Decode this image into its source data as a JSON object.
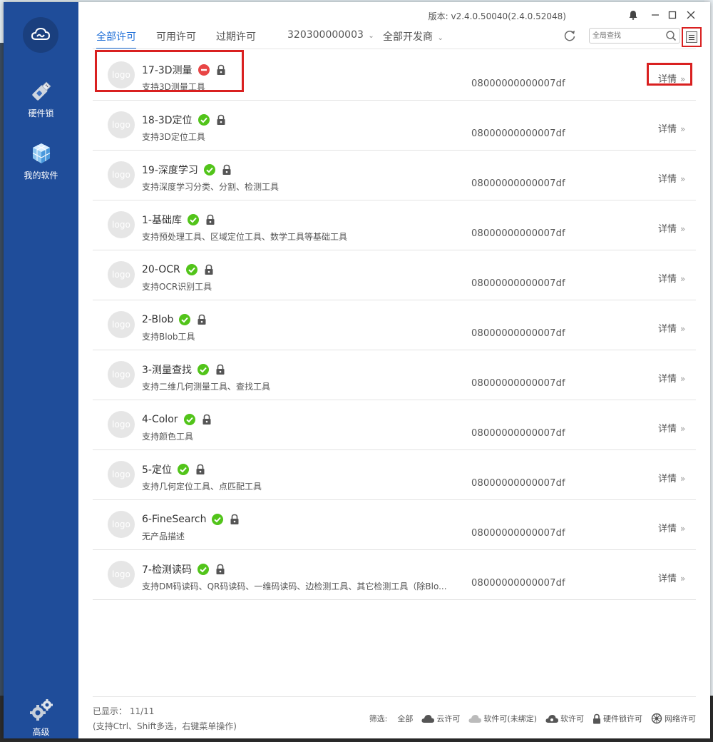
{
  "window": {
    "version": "版本: v2.4.0.50040(2.4.0.52048)"
  },
  "sidebar": {
    "items": [
      {
        "label": "硬件锁",
        "icon": "usb-dongle-icon"
      },
      {
        "label": "我的软件",
        "icon": "cubes-icon"
      },
      {
        "label": "高级",
        "icon": "gears-icon"
      }
    ]
  },
  "tabs": [
    {
      "label": "全部许可",
      "active": true
    },
    {
      "label": "可用许可",
      "active": false
    },
    {
      "label": "过期许可",
      "active": false
    }
  ],
  "filters_top": {
    "dongle_select": "320300000003",
    "vendor_select": "全部开发商"
  },
  "search": {
    "placeholder": "全局查找"
  },
  "licenses": [
    {
      "name": "17-3D测量",
      "status": "invalid",
      "desc": "支持3D测量工具",
      "serial": "08000000000007df",
      "detail": "详情"
    },
    {
      "name": "18-3D定位",
      "status": "valid",
      "desc": "支持3D定位工具",
      "serial": "08000000000007df",
      "detail": "详情"
    },
    {
      "name": "19-深度学习",
      "status": "valid",
      "desc": "支持深度学习分类、分割、检测工具",
      "serial": "08000000000007df",
      "detail": "详情"
    },
    {
      "name": "1-基础库",
      "status": "valid",
      "desc": "支持预处理工具、区域定位工具、数学工具等基础工具",
      "serial": "08000000000007df",
      "detail": "详情"
    },
    {
      "name": "20-OCR",
      "status": "valid",
      "desc": "支持OCR识别工具",
      "serial": "08000000000007df",
      "detail": "详情"
    },
    {
      "name": "2-Blob",
      "status": "valid",
      "desc": "支持Blob工具",
      "serial": "08000000000007df",
      "detail": "详情"
    },
    {
      "name": "3-测量查找",
      "status": "valid",
      "desc": "支持二维几何测量工具、查找工具",
      "serial": "08000000000007df",
      "detail": "详情"
    },
    {
      "name": "4-Color",
      "status": "valid",
      "desc": "支持颜色工具",
      "serial": "08000000000007df",
      "detail": "详情"
    },
    {
      "name": "5-定位",
      "status": "valid",
      "desc": "支持几何定位工具、点匹配工具",
      "serial": "08000000000007df",
      "detail": "详情"
    },
    {
      "name": "6-FineSearch",
      "status": "valid",
      "desc": "无产品描述",
      "serial": "08000000000007df",
      "detail": "详情"
    },
    {
      "name": "7-检测读码",
      "status": "valid",
      "desc": "支持DM码读码、QR码读码、一维码读码、边检测工具、其它检测工具（除Blo...",
      "serial": "08000000000007df",
      "detail": "详情"
    }
  ],
  "logo_placeholder": "logo",
  "footer": {
    "shown": "已显示：  11/11",
    "hint": "(支持Ctrl、Shift多选，右键菜单操作)",
    "filter_label": "筛选:",
    "filters": [
      "全部",
      "云许可",
      "软件可(未绑定)",
      "软许可",
      "硬件锁许可",
      "网络许可"
    ]
  },
  "colors": {
    "sidebar": "#1f4d9a",
    "accent": "#1f6fd8",
    "valid": "#52c41a",
    "invalid": "#e84545",
    "highlight": "#d92020"
  }
}
